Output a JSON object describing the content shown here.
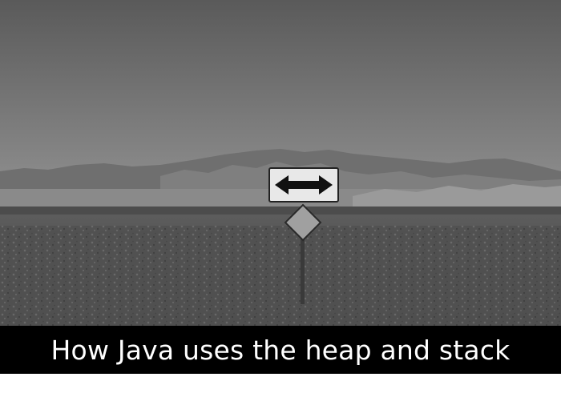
{
  "photo": {
    "style": "black-and-white",
    "subject": "road sign with double-headed arrow",
    "icons": [
      "double-arrow-icon"
    ]
  },
  "caption": {
    "text": "How Java uses the heap and stack",
    "background": "#000000",
    "color": "#ffffff"
  }
}
